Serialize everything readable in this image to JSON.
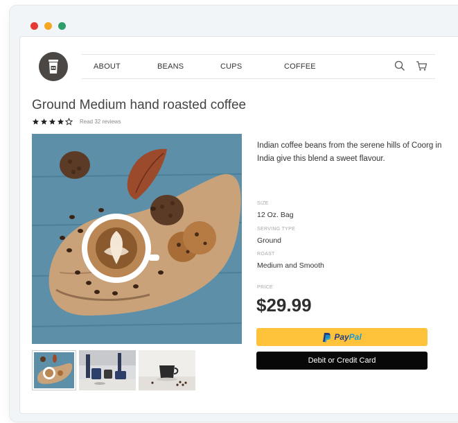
{
  "window": {
    "controls": [
      {
        "name": "close",
        "color": "#e53935"
      },
      {
        "name": "minimize",
        "color": "#f5a623"
      },
      {
        "name": "maximize",
        "color": "#2e9e6b"
      }
    ]
  },
  "nav": {
    "items": [
      "ABOUT",
      "BEANS",
      "CUPS",
      "COFFEE"
    ],
    "icons": [
      "search-icon",
      "cart-icon"
    ]
  },
  "product": {
    "title": "Ground Medium hand roasted coffee",
    "rating": 4,
    "rating_max": 5,
    "reviews_link": "Read 32 reviews",
    "description": "Indian coffee beans from the serene hills of Coorg in India give this blend a sweet flavour.",
    "specs": [
      {
        "label": "SIZE",
        "value": "12 Oz. Bag"
      },
      {
        "label": "SERVING TYPE",
        "value": "Ground"
      },
      {
        "label": "ROAST",
        "value": "Medium and Smooth"
      }
    ],
    "price_label": "PRICE",
    "price": "$29.99",
    "paypal_pay": "Pay",
    "paypal_pal": "Pal",
    "card_button": "Debit or Credit Card"
  },
  "colors": {
    "accent_paypal": "#fec33a",
    "paypal_dark": "#253b80",
    "paypal_light": "#179bd7",
    "card_button_bg": "#080808",
    "logo_bg": "#4a4744"
  }
}
